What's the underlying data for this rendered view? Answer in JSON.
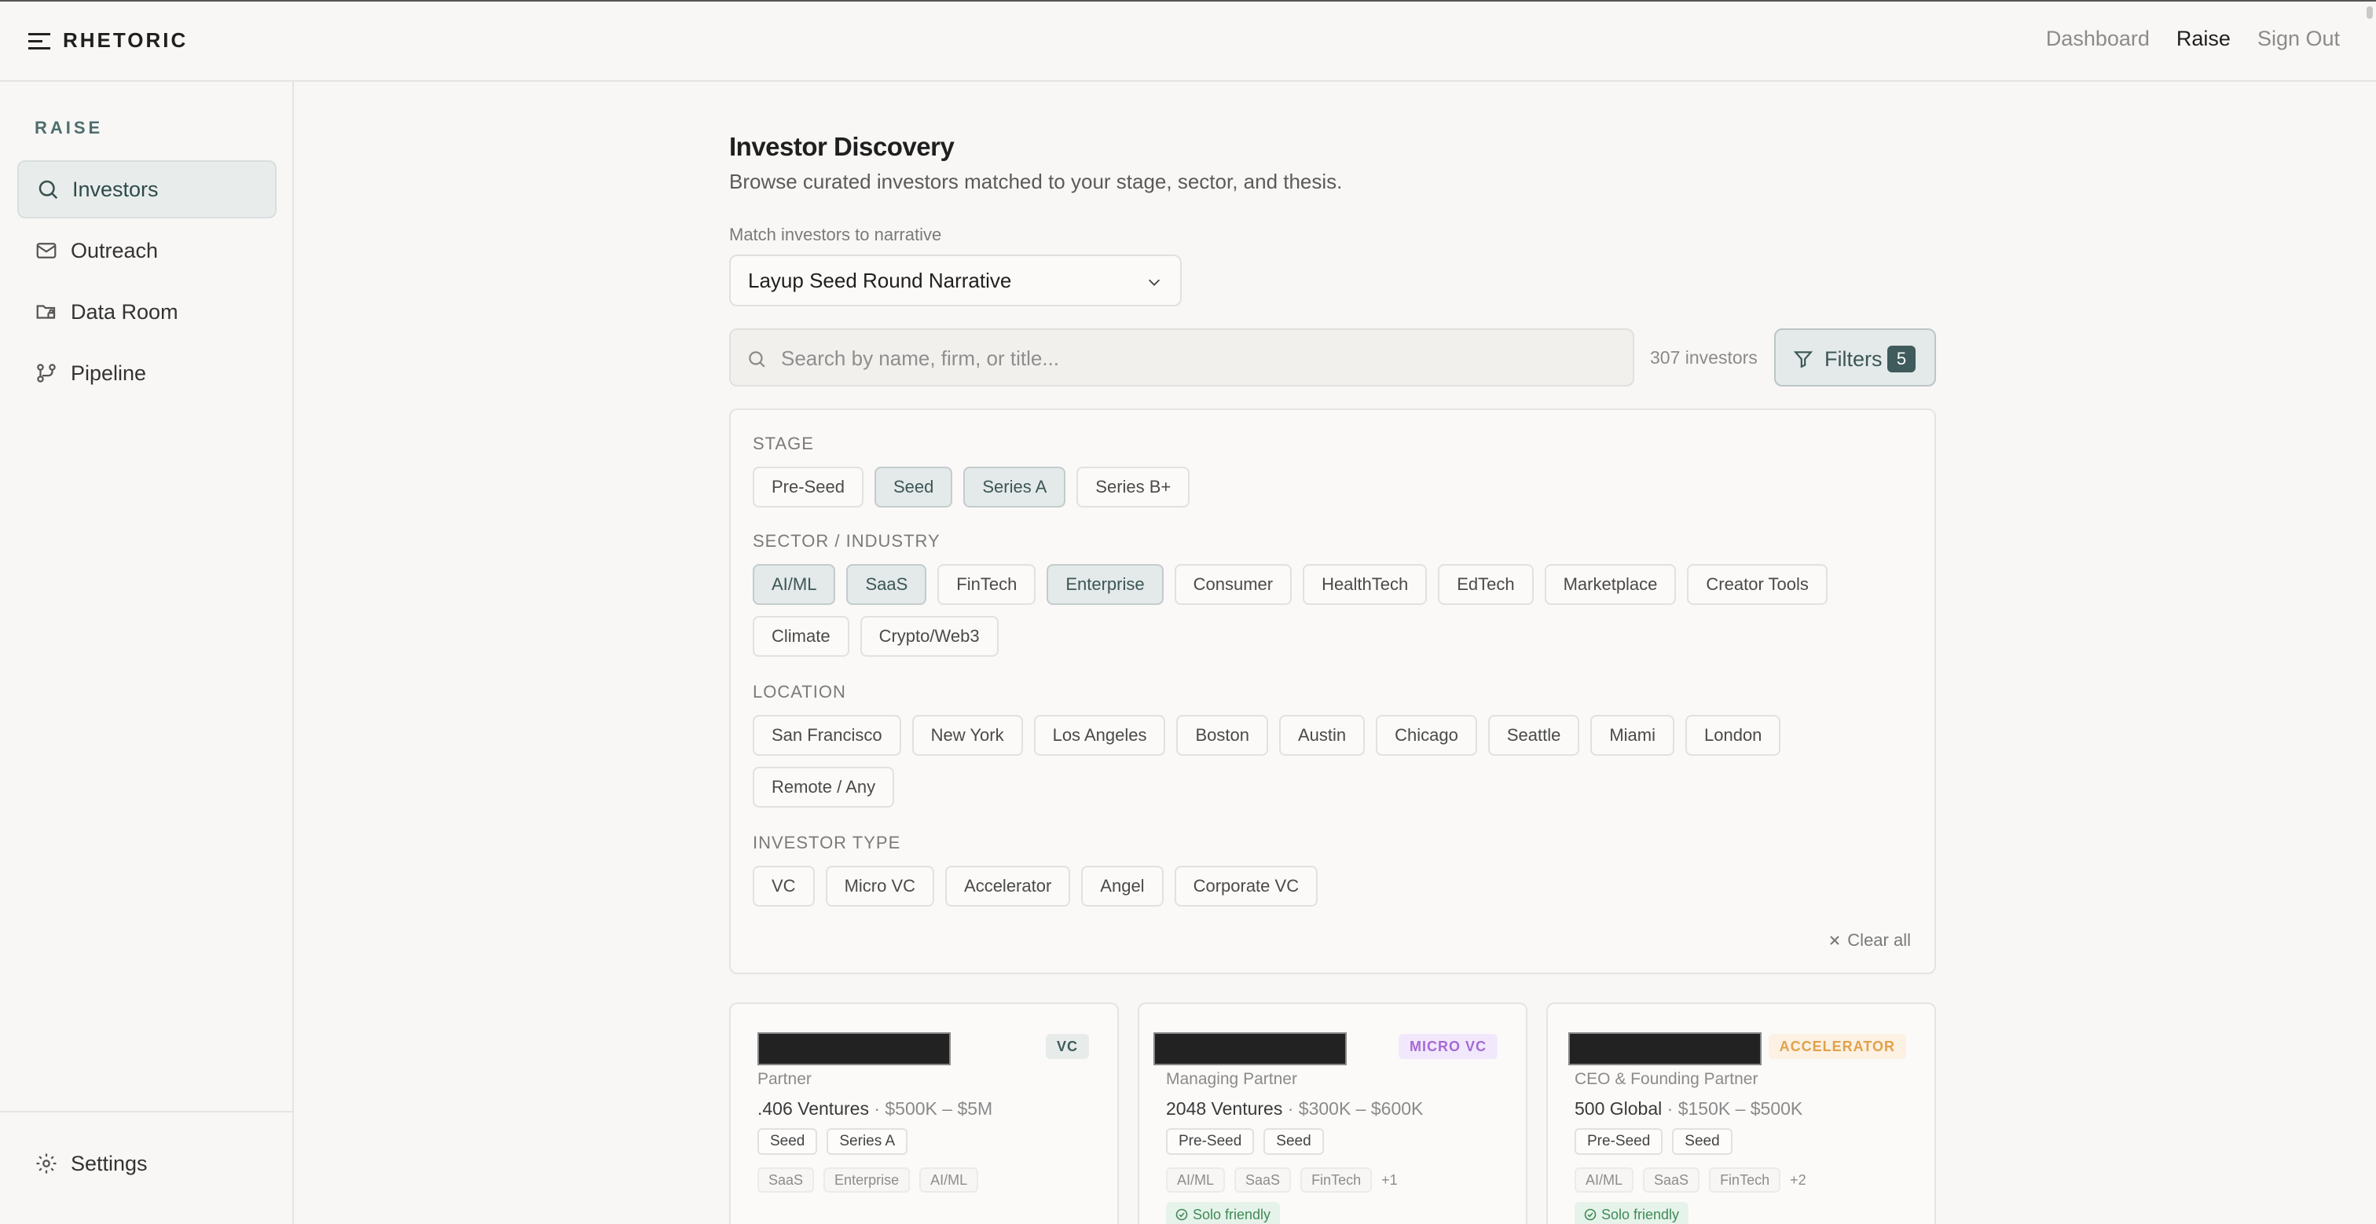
{
  "header": {
    "brand": "RHETORIC",
    "nav": [
      "Dashboard",
      "Raise",
      "Sign Out"
    ],
    "active_nav": "Raise"
  },
  "sidebar": {
    "heading": "RAISE",
    "items": [
      {
        "label": "Investors",
        "icon": "search-icon",
        "active": true
      },
      {
        "label": "Outreach",
        "icon": "mail-icon",
        "active": false
      },
      {
        "label": "Data Room",
        "icon": "folder-lock-icon",
        "active": false
      },
      {
        "label": "Pipeline",
        "icon": "pipeline-icon",
        "active": false
      }
    ],
    "settings_label": "Settings"
  },
  "main": {
    "title": "Investor Discovery",
    "subtitle": "Browse curated investors matched to your stage, sector, and thesis.",
    "match_label": "Match investors to narrative",
    "narrative_value": "Layup Seed Round Narrative",
    "search_placeholder": "Search by name, firm, or title...",
    "investor_count": "307 investors",
    "filters_label": "Filters",
    "filters_count": "5"
  },
  "filters": {
    "stage": {
      "heading": "STAGE",
      "options": [
        "Pre-Seed",
        "Seed",
        "Series A",
        "Series B+"
      ],
      "selected": [
        "Seed",
        "Series A"
      ]
    },
    "sector": {
      "heading": "SECTOR / INDUSTRY",
      "options": [
        "AI/ML",
        "SaaS",
        "FinTech",
        "Enterprise",
        "Consumer",
        "HealthTech",
        "EdTech",
        "Marketplace",
        "Creator Tools",
        "Climate",
        "Crypto/Web3"
      ],
      "selected": [
        "AI/ML",
        "SaaS",
        "Enterprise"
      ]
    },
    "location": {
      "heading": "LOCATION",
      "options": [
        "San Francisco",
        "New York",
        "Los Angeles",
        "Boston",
        "Austin",
        "Chicago",
        "Seattle",
        "Miami",
        "London",
        "Remote / Any"
      ],
      "selected": []
    },
    "type": {
      "heading": "INVESTOR TYPE",
      "options": [
        "VC",
        "Micro VC",
        "Accelerator",
        "Angel",
        "Corporate VC"
      ],
      "selected": []
    },
    "clear_all": "Clear all"
  },
  "cards": [
    {
      "type": "VC",
      "type_color": "#3f5b5b",
      "type_bg": "#e7eceb",
      "role": "Partner",
      "firm": ".406 Ventures",
      "range": " · $500K – $5M",
      "stages": [
        "Seed",
        "Series A"
      ],
      "sectors": [
        "SaaS",
        "Enterprise",
        "AI/ML"
      ],
      "more": "",
      "solo": ""
    },
    {
      "type": "MICRO VC",
      "type_color": "#a46ad6",
      "type_bg": "#f2e8fb",
      "role": "Managing Partner",
      "firm": "2048 Ventures",
      "range": " · $300K – $600K",
      "stages": [
        "Pre-Seed",
        "Seed"
      ],
      "sectors": [
        "AI/ML",
        "SaaS",
        "FinTech"
      ],
      "more": "+1",
      "solo": "Solo friendly"
    },
    {
      "type": "ACCELERATOR",
      "type_color": "#e0a24a",
      "type_bg": "#fcf1e2",
      "role": "CEO & Founding Partner",
      "firm": "500 Global",
      "range": " · $150K – $500K",
      "stages": [
        "Pre-Seed",
        "Seed"
      ],
      "sectors": [
        "AI/ML",
        "SaaS",
        "FinTech"
      ],
      "more": "+2",
      "solo": "Solo friendly"
    }
  ]
}
